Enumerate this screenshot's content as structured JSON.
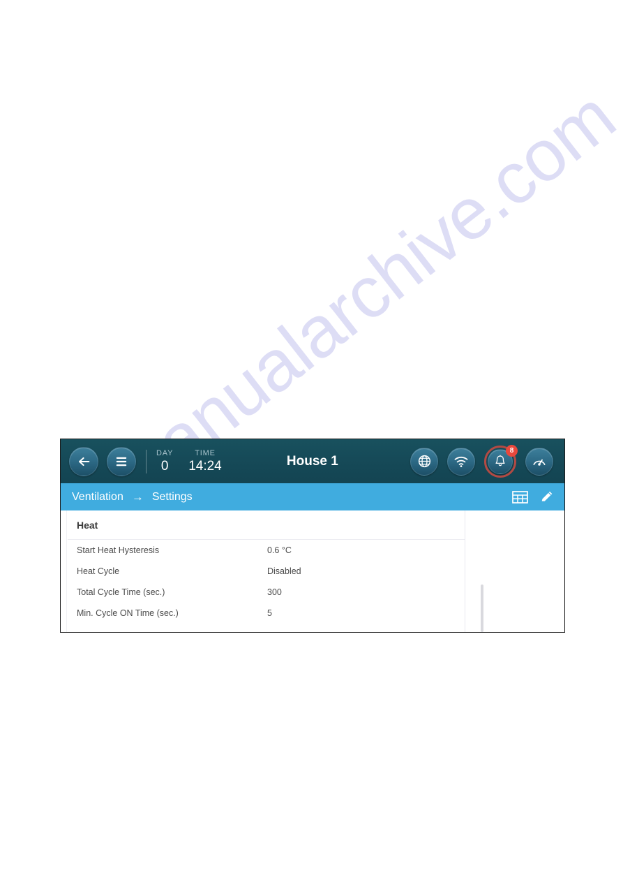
{
  "watermark": {
    "text": "manualarchive.com"
  },
  "toolbar": {
    "back_label": "Back",
    "menu_label": "Menu",
    "day_label": "DAY",
    "day_value": "0",
    "time_label": "TIME",
    "time_value": "14:24",
    "house_title": "House 1",
    "icons": {
      "globe": "globe-icon",
      "wifi": "wifi-icon",
      "bell": "bell-icon",
      "gauge": "gauge-icon"
    },
    "alarm_badge_count": "8"
  },
  "breadcrumb": {
    "root": "Ventilation",
    "separator": "→",
    "current": "Settings",
    "table_view_label": "Table view",
    "edit_label": "Edit"
  },
  "table": {
    "section_title": "Heat",
    "rows": [
      {
        "label": "Start Heat Hysteresis",
        "value": "0.6 °C"
      },
      {
        "label": "Heat Cycle",
        "value": "Disabled"
      },
      {
        "label": "Total Cycle Time (sec.)",
        "value": "300"
      },
      {
        "label": "Min. Cycle ON Time (sec.)",
        "value": "5"
      }
    ]
  },
  "colors": {
    "toolbar_bg": "#164b59",
    "breadcrumb_bg": "#40acdf",
    "badge_red": "#e8483c",
    "bell_ring": "#b24a44",
    "button_blue": "#2d6a86",
    "watermark": "#c9c9ef"
  }
}
